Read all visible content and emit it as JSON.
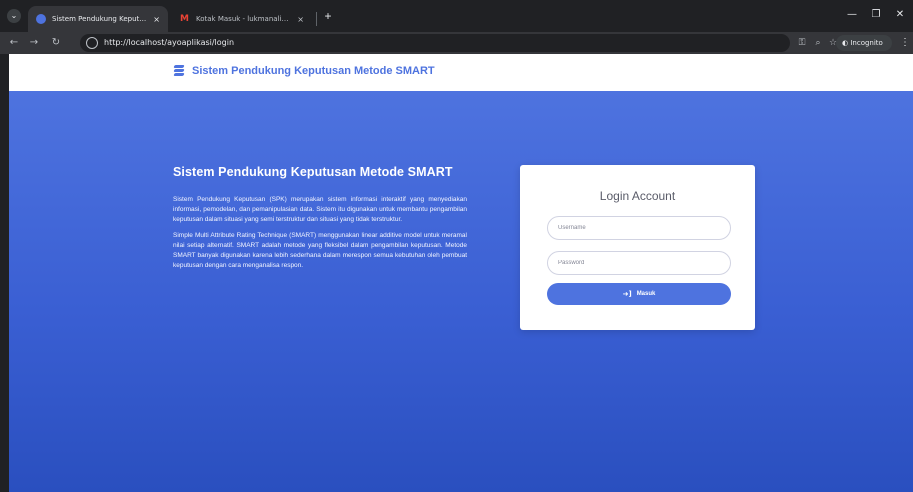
{
  "browser": {
    "tabs": [
      {
        "title": "Sistem Pendukung Keputusan",
        "favicon_color": "#4e73df",
        "active": true
      },
      {
        "title": "Kotak Masuk - lukmanaliyasin",
        "favicon_color": "#ea4335",
        "active": false
      }
    ],
    "close_glyph": "×",
    "new_tab_glyph": "+",
    "url": "http://localhost/ayoaplikasi/login",
    "incognito_label": "Incognito",
    "icons": [
      "tab-search-icon",
      "back-icon",
      "forward-icon",
      "reload-icon",
      "site-info-icon",
      "password-key-icon",
      "zoom-icon",
      "bookmark-star-icon",
      "incognito-icon",
      "menu-icon",
      "minimize-icon",
      "restore-icon",
      "close-window-icon"
    ]
  },
  "navbar": {
    "brand": "Sistem Pendukung Keputusan Metode SMART"
  },
  "info": {
    "title": "Sistem Pendukung Keputusan Metode SMART",
    "paragraph1": "Sistem Pendukung Keputusan (SPK) merupakan sistem informasi interaktif yang menyediakan informasi, pemodelan, dan pemanipulasian data. Sistem itu digunakan untuk membantu pengambilan keputusan dalam situasi yang semi terstruktur dan situasi yang tidak terstruktur.",
    "paragraph2": "Simple Multi Attribute Rating Technique (SMART) menggunakan linear additive model untuk meramal nilai setiap alternatif. SMART adalah metode yang fleksibel dalam pengambilan keputusan. Metode SMART banyak digunakan karena lebih sederhana dalam merespon semua kebutuhan oleh pembuat keputusan dengan cara menganalisa respon."
  },
  "login": {
    "title": "Login Account",
    "username_placeholder": "Username",
    "password_placeholder": "Password",
    "submit_label": "Masuk"
  },
  "colors": {
    "accent": "#4e73df",
    "hero_dark": "#2a4fbf"
  }
}
